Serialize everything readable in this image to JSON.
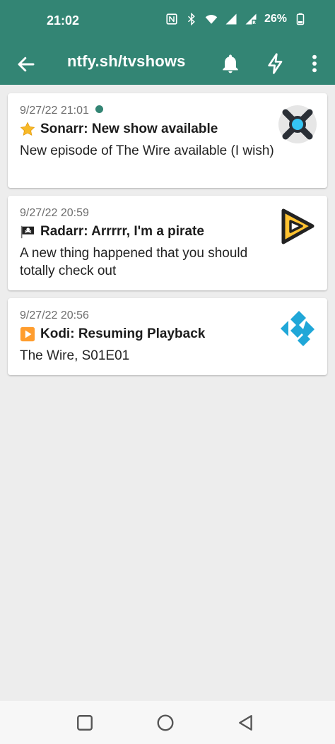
{
  "status_bar": {
    "time": "21:02",
    "battery_percent": "26%",
    "icons": [
      "nfc-icon",
      "bluetooth-icon",
      "wifi-icon",
      "signal-icon",
      "signal-roaming-icon",
      "battery-icon"
    ]
  },
  "app_bar": {
    "title": "ntfy.sh/tvshows",
    "actions": [
      "back-arrow-icon",
      "bell-icon",
      "lightning-icon",
      "more-vert-icon"
    ]
  },
  "colors": {
    "primary": "#338574",
    "background": "#ededed",
    "card": "#ffffff"
  },
  "notifications": [
    {
      "date": "9/27/22 21:01",
      "unread": true,
      "emoji": "star-icon",
      "title": "Sonarr: New show available",
      "message": "New episode of The Wire available (I wish)",
      "attachment_icon": "sonarr-icon"
    },
    {
      "date": "9/27/22 20:59",
      "unread": false,
      "emoji": "pirate-flag-icon",
      "title": "Radarr: Arrrrr, I'm a pirate",
      "message": "A new thing happened that you should totally check out",
      "attachment_icon": "radarr-icon"
    },
    {
      "date": "9/27/22 20:56",
      "unread": false,
      "emoji": "play-button-icon",
      "title": "Kodi: Resuming Playback",
      "message": "The Wire, S01E01",
      "attachment_icon": "kodi-icon"
    }
  ],
  "nav_bar": [
    "recents-square-icon",
    "home-circle-icon",
    "back-triangle-icon"
  ]
}
